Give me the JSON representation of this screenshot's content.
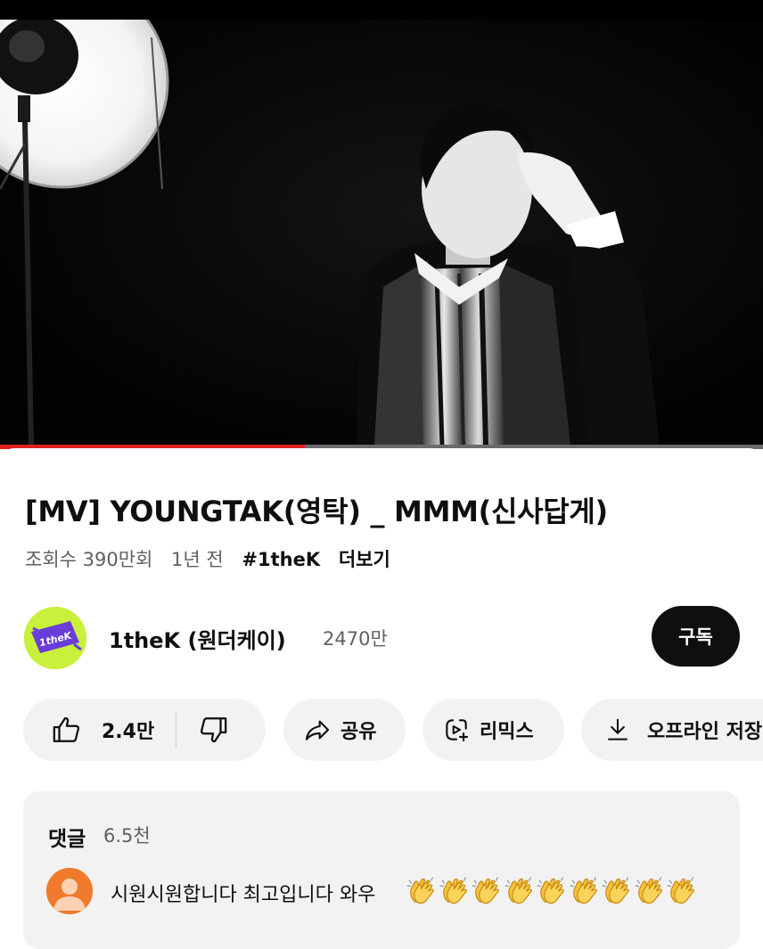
{
  "player": {
    "progress_fraction": 0.4
  },
  "video": {
    "title": "[MV] YOUNGTAK(영탁) _ MMM(신사답게)",
    "views": "조회수 390만회",
    "age": "1년 전",
    "hashtag": "#1theK",
    "more_label": "더보기"
  },
  "channel": {
    "avatar_text": "1theK",
    "name": "1theK (원더케이)",
    "subscribers": "2470만",
    "subscribe_label": "구독"
  },
  "actions": {
    "like_count": "2.4만",
    "share_label": "공유",
    "remix_label": "리믹스",
    "offline_label": "오프라인 저장"
  },
  "comments": {
    "title": "댓글",
    "count": "6.5천",
    "top_comment": "시원시원합니다 최고입니다 와우",
    "top_comment_emoji": "👏",
    "top_comment_emoji_count": 9
  },
  "colors": {
    "progress_played": "#e02020",
    "channel_avatar_bg": "#c8f03c",
    "subscribe_bg": "#0f0f0f",
    "commenter_avatar_bg": "#f07a2b"
  },
  "icons": {
    "like": "thumbs-up-icon",
    "dislike": "thumbs-down-icon",
    "share": "share-arrow-icon",
    "remix": "remix-icon",
    "offline": "download-icon",
    "commenter": "default-avatar-icon"
  }
}
